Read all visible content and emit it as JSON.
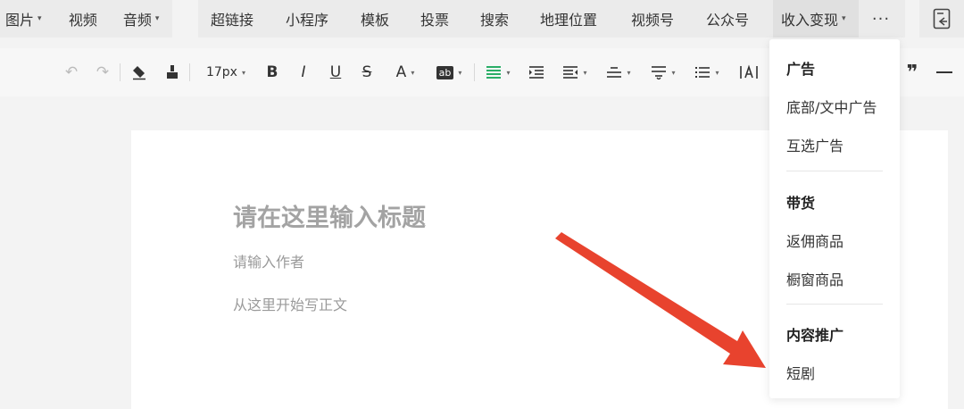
{
  "top_menu": {
    "left_items": [
      {
        "label": "图片",
        "has_caret": true
      },
      {
        "label": "视频",
        "has_caret": false
      },
      {
        "label": "音频",
        "has_caret": true
      }
    ],
    "mid_items": [
      {
        "label": "超链接"
      },
      {
        "label": "小程序"
      },
      {
        "label": "模板"
      },
      {
        "label": "投票"
      },
      {
        "label": "搜索"
      },
      {
        "label": "地理位置"
      },
      {
        "label": "视频号"
      },
      {
        "label": "公众号"
      },
      {
        "label": "收入变现",
        "has_caret": true,
        "active": true
      }
    ],
    "more_label": "···"
  },
  "format_toolbar": {
    "font_size": "17px",
    "bold": "B",
    "italic": "I",
    "underline": "U",
    "strike": "S",
    "font_color": "A",
    "bg_color": "ab",
    "accent_color": "#2aae67"
  },
  "editor": {
    "title_placeholder": "请在这里输入标题",
    "author_placeholder": "请输入作者",
    "body_placeholder": "从这里开始写正文"
  },
  "monetize_menu": {
    "sections": [
      {
        "heading": "广告",
        "items": [
          "底部/文中广告",
          "互选广告"
        ]
      },
      {
        "heading": "带货",
        "items": [
          "返佣商品",
          "橱窗商品"
        ]
      },
      {
        "heading": "内容推广",
        "items": [
          "短剧"
        ]
      }
    ]
  },
  "annotation": {
    "arrow_color": "#e8432e"
  }
}
